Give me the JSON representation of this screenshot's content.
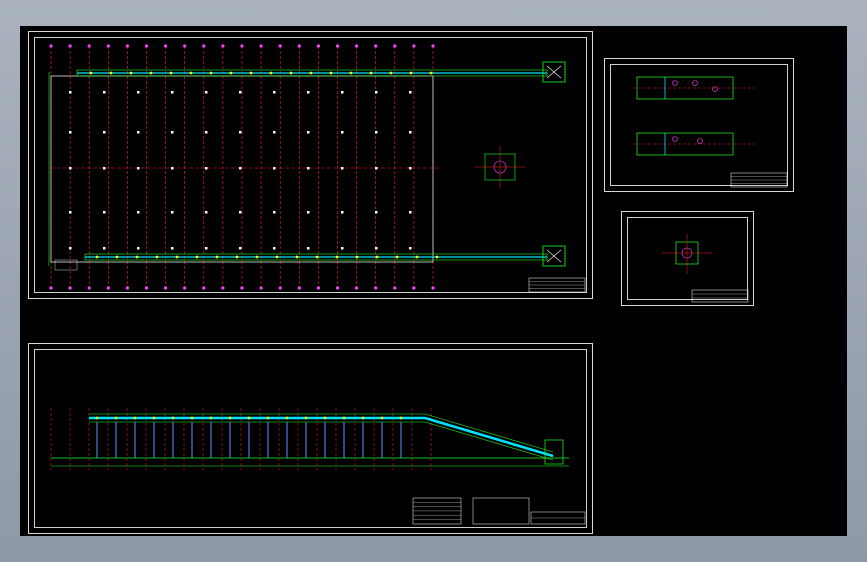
{
  "app": {
    "type": "CAD drawing preview",
    "background_color": "#000000",
    "frame_color": "#8f99a6"
  },
  "colors": {
    "axis_line": "#ff2020",
    "axis_bubble": "#ff40ff",
    "structure": "#22ff22",
    "conveyor": "#00e5ff",
    "roller": "#ffff00",
    "dimension": "#ff40ff",
    "border": "#d8d8d8"
  },
  "sheets": [
    {
      "id": "plan",
      "label": "conveyor-plan-view"
    },
    {
      "id": "elevation",
      "label": "conveyor-elevation-view"
    },
    {
      "id": "detail-a",
      "label": "drive-detail-sheet"
    },
    {
      "id": "detail-b",
      "label": "section-detail-sheet"
    }
  ]
}
